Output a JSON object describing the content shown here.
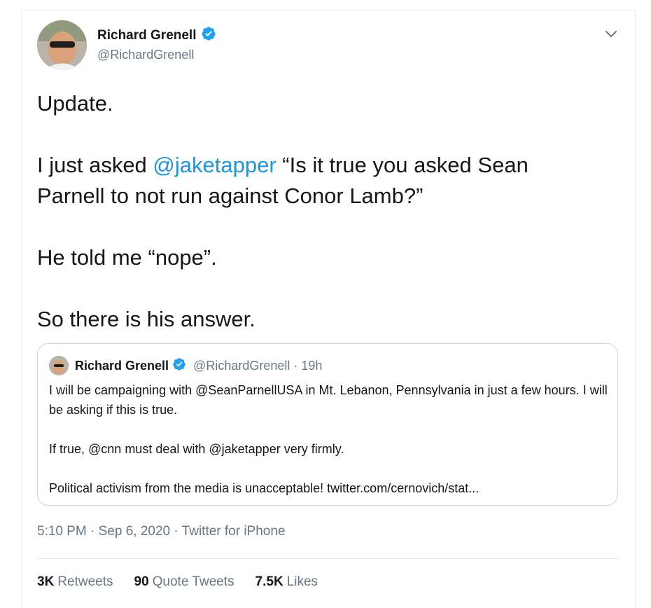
{
  "author": {
    "name": "Richard Grenell",
    "handle": "@RichardGrenell"
  },
  "tweet": {
    "line1": "Update.",
    "line2_before": "I just asked ",
    "line2_mention": "@jaketapper",
    "line2_after": " “Is it true you asked Sean Parnell to not run against Conor Lamb?”",
    "line3": "He told me “nope”.",
    "line4": "So there is his answer."
  },
  "quote": {
    "name": "Richard Grenell",
    "handle_time": "@RichardGrenell · 19h",
    "para1": "I will be campaigning with @SeanParnellUSA in Mt. Lebanon, Pennsylvania in just a few hours. I will be asking if this is true.",
    "para2": "If true, @cnn must deal with @jaketapper very firmly.",
    "para3": "Political activism from the media is unacceptable! twitter.com/cernovich/stat..."
  },
  "meta": "5:10 PM · Sep 6, 2020 · Twitter for iPhone",
  "stats": {
    "retweets_count": "3K",
    "retweets_label": "Retweets",
    "quotes_count": "90",
    "quotes_label": "Quote Tweets",
    "likes_count": "7.5K",
    "likes_label": "Likes"
  },
  "colors": {
    "link": "#1b95e0",
    "verified": "#1da1f2",
    "secondary_text": "#657786",
    "border": "#ccd6dd"
  },
  "icons": [
    "verified-badge-icon",
    "chevron-down-icon"
  ]
}
